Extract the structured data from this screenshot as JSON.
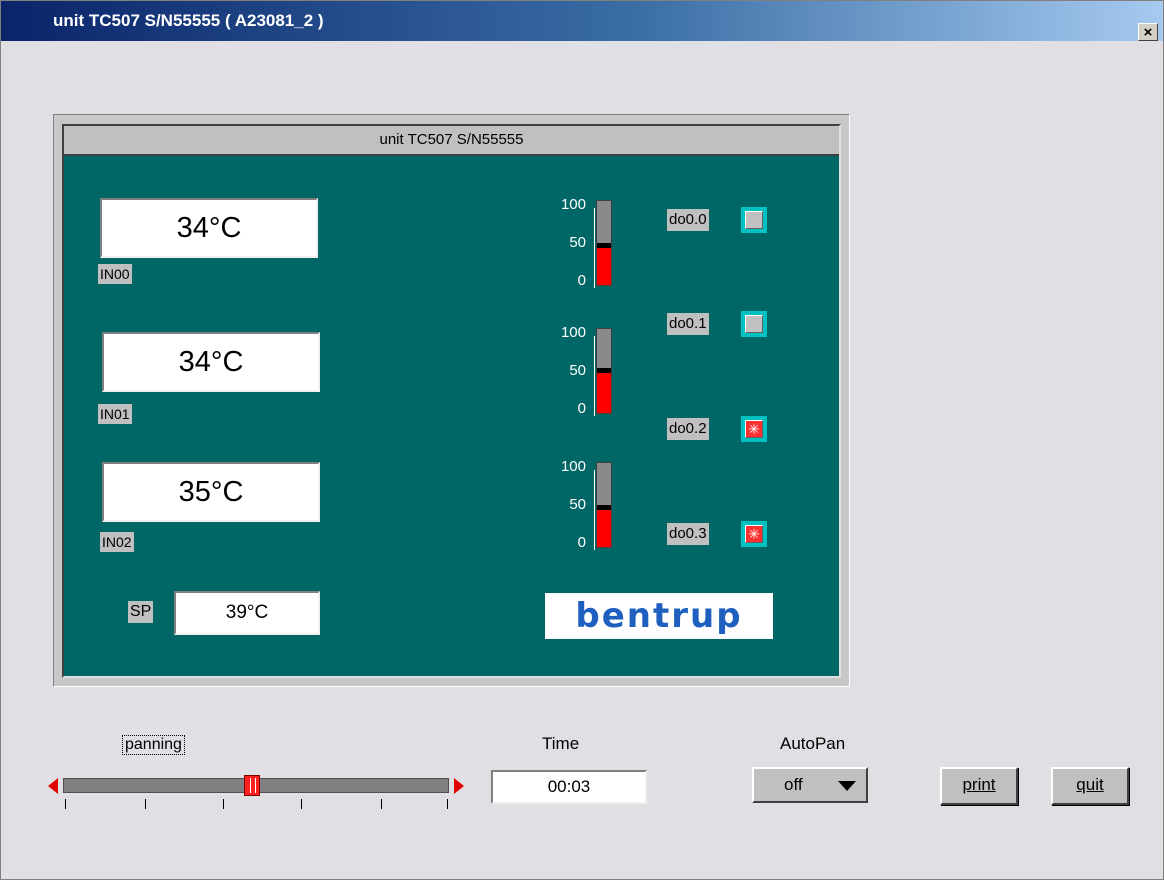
{
  "window": {
    "title": "unit TC507 S/N55555 ( A23081_2 )",
    "close_label": "×"
  },
  "panel": {
    "header": "unit TC507 S/N55555",
    "inputs": [
      {
        "value": "34°C",
        "label": "IN00"
      },
      {
        "value": "34°C",
        "label": "IN01"
      },
      {
        "value": "35°C",
        "label": "IN02"
      }
    ],
    "setpoint": {
      "label": "SP",
      "value": "39°C"
    },
    "gauges": [
      {
        "ticks": [
          "100",
          "50",
          "0"
        ],
        "level_percent": 50
      },
      {
        "ticks": [
          "100",
          "50",
          "0"
        ],
        "level_percent": 53
      },
      {
        "ticks": [
          "100",
          "50",
          "0"
        ],
        "level_percent": 50
      }
    ],
    "outputs": [
      {
        "label": "do0.0",
        "state": "off"
      },
      {
        "label": "do0.1",
        "state": "off"
      },
      {
        "label": "do0.2",
        "state": "on"
      },
      {
        "label": "do0.3",
        "state": "on"
      }
    ],
    "logo_text": "bentrup"
  },
  "controls": {
    "panning_label": "panning",
    "slider_value_percent": 49,
    "time_label": "Time",
    "time_value": "00:03",
    "autopan_label": "AutoPan",
    "autopan_value": "off",
    "print_label": "print",
    "quit_label": "quit"
  },
  "colors": {
    "panel_bg": "#006666",
    "bar_fill": "#ff0000",
    "led_on": "#ff3030",
    "led_frame": "#00c0c0",
    "logo": "#1f5fbf"
  }
}
